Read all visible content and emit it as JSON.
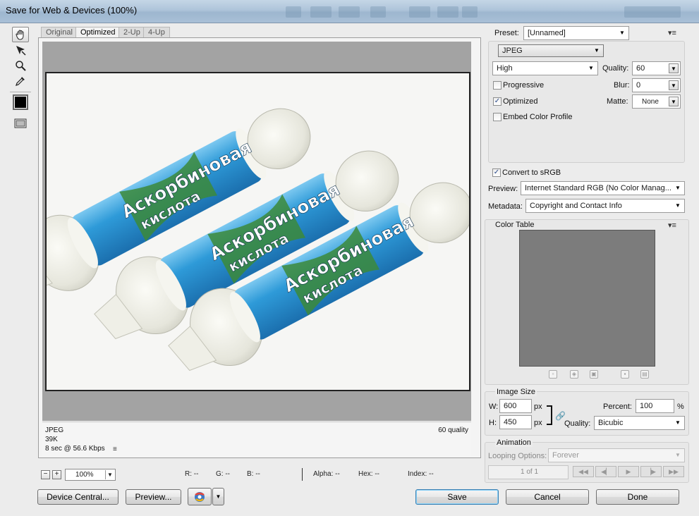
{
  "window": {
    "title": "Save for Web & Devices (100%)"
  },
  "tabs": [
    {
      "label": "Original"
    },
    {
      "label": "Optimized"
    },
    {
      "label": "2-Up"
    },
    {
      "label": "4-Up"
    }
  ],
  "tools": [
    "hand-icon",
    "slice-select-icon",
    "zoom-icon",
    "eyedropper-icon",
    "eyedropper-color-icon",
    "toggle-slices-icon"
  ],
  "image_text": {
    "line1": "Аскорбиновая",
    "line2": "кислота"
  },
  "info": {
    "format": "JPEG",
    "size": "39K",
    "time": "8 sec @ 56.6 Kbps",
    "quality": "60 quality"
  },
  "status": {
    "zoom": "100%",
    "r": "R: --",
    "g": "G: --",
    "b": "B: --",
    "alpha": "Alpha: --",
    "hex": "Hex: --",
    "index": "Index: --"
  },
  "buttons": {
    "device_central": "Device Central...",
    "preview": "Preview...",
    "save": "Save",
    "cancel": "Cancel",
    "done": "Done"
  },
  "settings": {
    "preset_label": "Preset:",
    "preset_value": "[Unnamed]",
    "format": "JPEG",
    "compression": "High",
    "quality_label": "Quality:",
    "quality_value": "60",
    "progressive_label": "Progressive",
    "progressive_checked": false,
    "blur_label": "Blur:",
    "blur_value": "0",
    "optimized_label": "Optimized",
    "optimized_checked": true,
    "matte_label": "Matte:",
    "matte_value": "None",
    "embed_label": "Embed Color Profile",
    "embed_checked": false,
    "convert_label": "Convert to sRGB",
    "convert_checked": true,
    "preview_label": "Preview:",
    "preview_value": "Internet Standard RGB (No Color Manag...",
    "metadata_label": "Metadata:",
    "metadata_value": "Copyright and Contact Info"
  },
  "color_table": {
    "title": "Color Table",
    "swatch_color": "#7c7c7c"
  },
  "image_size": {
    "title": "Image Size",
    "w_label": "W:",
    "w_value": "600",
    "h_label": "H:",
    "h_value": "450",
    "unit": "px",
    "percent_label": "Percent:",
    "percent_value": "100",
    "percent_unit": "%",
    "quality_label": "Quality:",
    "quality_value": "Bicubic"
  },
  "animation": {
    "title": "Animation",
    "looping_label": "Looping Options:",
    "looping_value": "Forever",
    "frame_counter": "1 of 1"
  },
  "colors": {
    "candy_blue": "#2e9ad8",
    "candy_green": "#3c8a3a",
    "wrapper": "#e6e6dc"
  }
}
